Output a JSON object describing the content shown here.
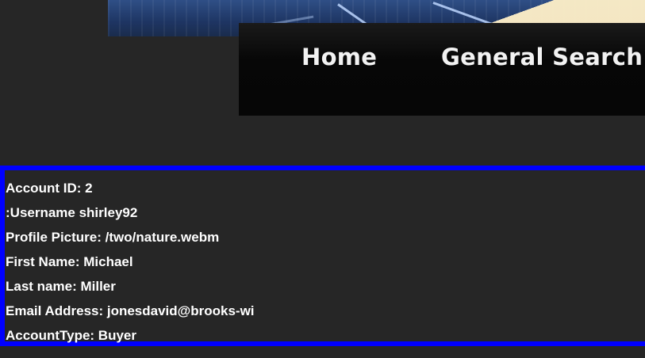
{
  "nav": {
    "home_label": "Home",
    "search_label": "General Search"
  },
  "account": {
    "lines": [
      "Account ID: 2",
      ":Username shirley92",
      "Profile Picture: /two/nature.webm",
      "First Name: Michael",
      "Last name: Miller",
      "Email Address: jonesdavid@brooks-wi",
      "AccountType: Buyer"
    ]
  },
  "colors": {
    "background": "#262626",
    "box_border": "#0000ff",
    "text": "#ffffff"
  }
}
